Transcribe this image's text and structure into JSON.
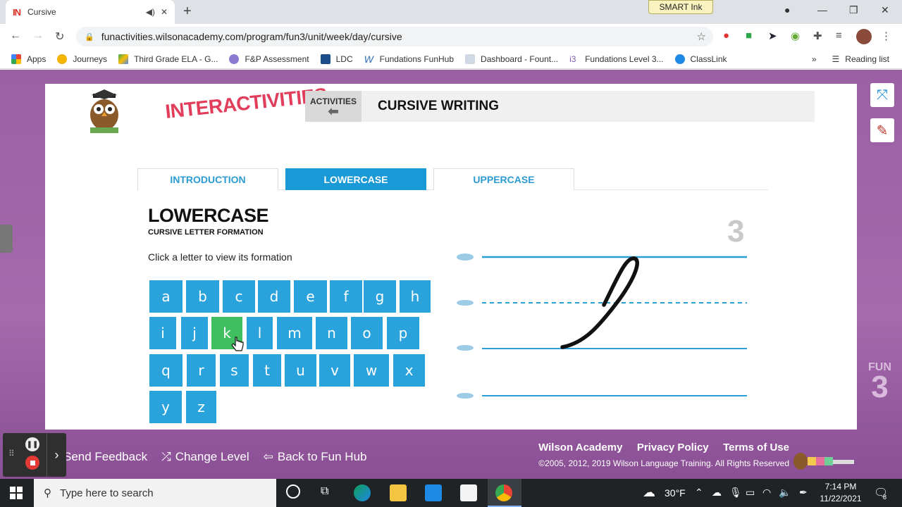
{
  "browser": {
    "tab_title": "Cursive",
    "tab_favicon": "IN",
    "smart_ink_label": "SMART Ink",
    "url": "funactivities.wilsonacademy.com/program/fun3/unit/week/day/cursive"
  },
  "bookmarks": {
    "items": [
      "Apps",
      "Journeys",
      "Third Grade ELA - G...",
      "F&P Assessment",
      "LDC",
      "Fundations FunHub",
      "Dashboard - Fount...",
      "Fundations Level 3...",
      "ClassLink"
    ],
    "overflow": "»",
    "reading_list": "Reading list"
  },
  "app": {
    "logo_text": "INTERACTIVITIES",
    "activities_label": "ACTIVITIES",
    "page_title": "CURSIVE WRITING",
    "tabs": [
      {
        "label": "INTRODUCTION"
      },
      {
        "label": "LOWERCASE"
      },
      {
        "label": "UPPERCASE"
      }
    ],
    "active_tab": "LOWERCASE",
    "heading": "LOWERCASE",
    "subheading": "CURSIVE LETTER FORMATION",
    "instruction": "Click a letter to view its formation",
    "letters": [
      "a",
      "b",
      "c",
      "d",
      "e",
      "f",
      "g",
      "h",
      "i",
      "j",
      "k",
      "l",
      "m",
      "n",
      "o",
      "p",
      "q",
      "r",
      "s",
      "t",
      "u",
      "v",
      "w",
      "x",
      "y",
      "z"
    ],
    "selected_letter": "k",
    "stroke_number": "3",
    "fun3_label": "FUN",
    "fun3_num": "3"
  },
  "footer": {
    "send_feedback": "Send Feedback",
    "change_level": "Change Level",
    "back_to_hub": "Back to Fun Hub",
    "wilson_academy": "Wilson Academy",
    "privacy_policy": "Privacy Policy",
    "terms_of_use": "Terms of Use",
    "copyright": "©2005, 2012, 2019 Wilson Language Training. All Rights Reserved"
  },
  "taskbar": {
    "search_placeholder": "Type here to search",
    "temperature": "30°F",
    "time": "7:14 PM",
    "date": "11/22/2021",
    "notifications": "8"
  },
  "colors": {
    "accent_blue": "#2aa3dc",
    "selected_green": "#3fbf5f",
    "page_purple": "#9b5fa3"
  }
}
